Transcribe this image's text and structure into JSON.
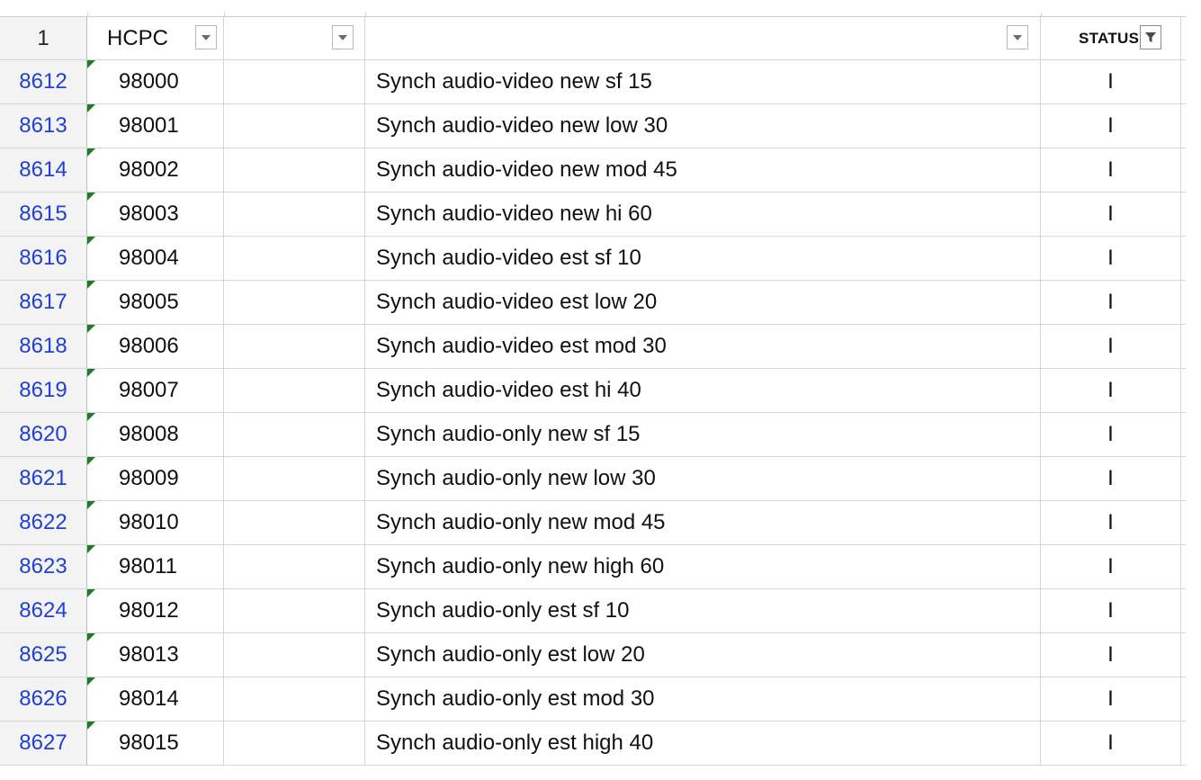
{
  "header": {
    "row_number": "1",
    "hcpc_label": "HCPC",
    "status_label": "STATUS"
  },
  "rows": [
    {
      "row": "8612",
      "code": "98000",
      "desc": "Synch audio-video new sf 15",
      "status": "I"
    },
    {
      "row": "8613",
      "code": "98001",
      "desc": "Synch audio-video new low 30",
      "status": "I"
    },
    {
      "row": "8614",
      "code": "98002",
      "desc": "Synch audio-video new mod 45",
      "status": "I"
    },
    {
      "row": "8615",
      "code": "98003",
      "desc": "Synch audio-video new hi 60",
      "status": "I"
    },
    {
      "row": "8616",
      "code": "98004",
      "desc": "Synch audio-video est sf 10",
      "status": "I"
    },
    {
      "row": "8617",
      "code": "98005",
      "desc": "Synch audio-video est low 20",
      "status": "I"
    },
    {
      "row": "8618",
      "code": "98006",
      "desc": "Synch audio-video est mod 30",
      "status": "I"
    },
    {
      "row": "8619",
      "code": "98007",
      "desc": "Synch audio-video est hi 40",
      "status": "I"
    },
    {
      "row": "8620",
      "code": "98008",
      "desc": "Synch audio-only new sf 15",
      "status": "I"
    },
    {
      "row": "8621",
      "code": "98009",
      "desc": "Synch audio-only new low 30",
      "status": "I"
    },
    {
      "row": "8622",
      "code": "98010",
      "desc": "Synch audio-only new mod 45",
      "status": "I"
    },
    {
      "row": "8623",
      "code": "98011",
      "desc": "Synch audio-only new high 60",
      "status": "I"
    },
    {
      "row": "8624",
      "code": "98012",
      "desc": "Synch audio-only est sf 10",
      "status": "I"
    },
    {
      "row": "8625",
      "code": "98013",
      "desc": "Synch audio-only est low 20",
      "status": "I"
    },
    {
      "row": "8626",
      "code": "98014",
      "desc": "Synch audio-only est mod 30",
      "status": "I"
    },
    {
      "row": "8627",
      "code": "98015",
      "desc": "Synch audio-only est high 40",
      "status": "I"
    }
  ],
  "colors": {
    "row_number_text": "#1f3fd6",
    "error_indicator": "#1d7d27",
    "gridline": "#d6d6d6"
  }
}
